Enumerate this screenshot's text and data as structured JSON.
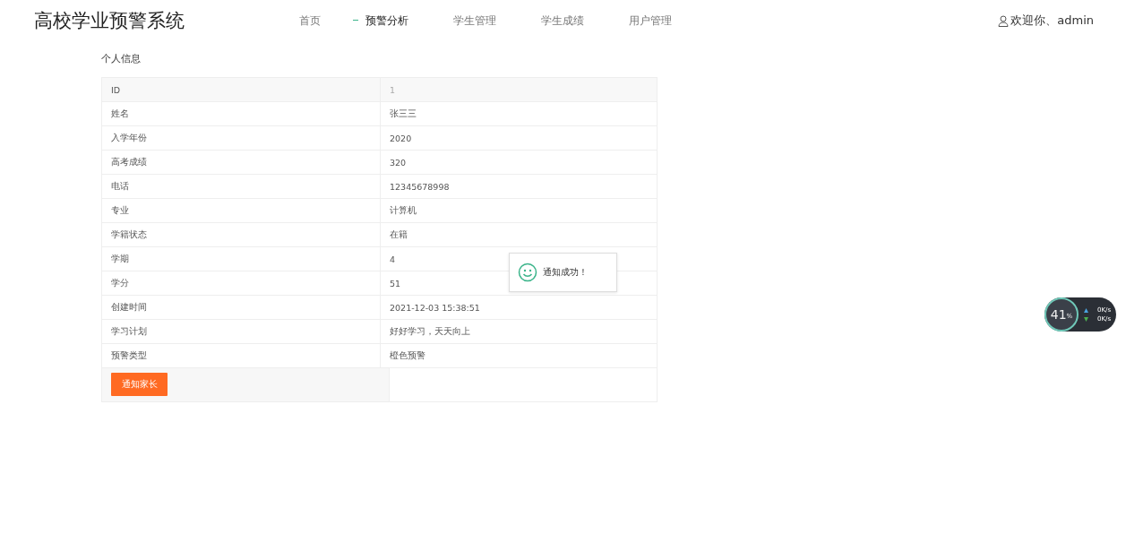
{
  "header": {
    "title": "高校学业预警系统",
    "nav": [
      {
        "label": "首页",
        "selected": false
      },
      {
        "label": "预警分析",
        "selected": true
      },
      {
        "label": "学生管理",
        "selected": false
      },
      {
        "label": "学生成绩",
        "selected": false
      },
      {
        "label": "用户管理",
        "selected": false
      }
    ],
    "user": "欢迎你、admin"
  },
  "section_title": "个人信息",
  "table": {
    "header_row": {
      "label": "ID",
      "value": "1"
    },
    "rows": [
      {
        "label": "姓名",
        "value": "张三三"
      },
      {
        "label": "入学年份",
        "value": "2020"
      },
      {
        "label": "高考成绩",
        "value": "320"
      },
      {
        "label": "电话",
        "value": "12345678998"
      },
      {
        "label": "专业",
        "value": "计算机"
      },
      {
        "label": "学籍状态",
        "value": "在籍"
      },
      {
        "label": "学期",
        "value": "4"
      },
      {
        "label": "学分",
        "value": "51"
      },
      {
        "label": "创建时间",
        "value": "2021-12-03 15:38:51"
      },
      {
        "label": "学习计划",
        "value": "好好学习，天天向上"
      },
      {
        "label": "预警类型",
        "value": "橙色预警"
      }
    ],
    "action_button": "通知家长"
  },
  "toast": {
    "message": "通知成功！"
  },
  "speed_widget": {
    "percent": "41",
    "unit": "%",
    "upload": "0K/s",
    "download": "0K/s"
  }
}
